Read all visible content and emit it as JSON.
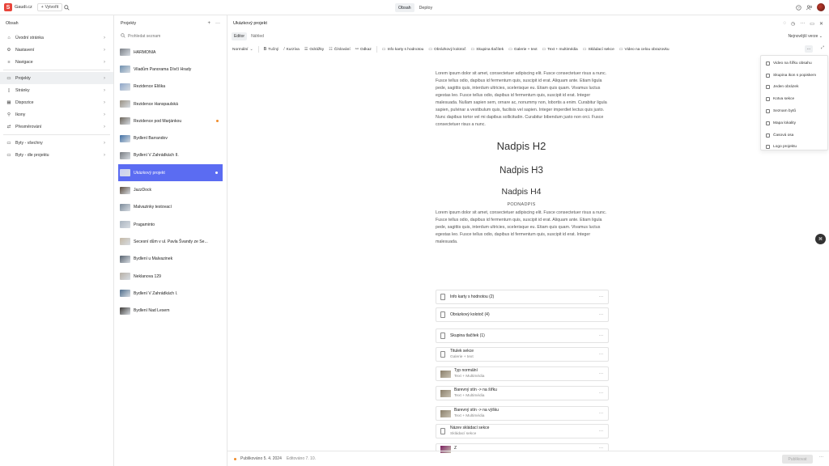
{
  "topbar": {
    "site_name": "Gaudi.cz",
    "create_label": "Vytvořit",
    "nav": [
      "Obsah",
      "Deploy"
    ]
  },
  "leftnav": {
    "title": "Obsah",
    "items": [
      {
        "label": "Úvodní stránka",
        "icon": "home-icon"
      },
      {
        "label": "Nastavení",
        "icon": "gear-icon"
      },
      {
        "label": "Navigace",
        "icon": "menu-icon"
      },
      {
        "label": "Projekty",
        "icon": "folder-icon"
      },
      {
        "label": "Stránky",
        "icon": "page-icon"
      },
      {
        "label": "Dispozice",
        "icon": "layout-icon"
      },
      {
        "label": "Ikony",
        "icon": "pin-icon"
      },
      {
        "label": "Přesměrování",
        "icon": "redirect-icon"
      },
      {
        "label": "Byty - všechny",
        "icon": "folder-icon"
      },
      {
        "label": "Byty - dle projektu",
        "icon": "folder-icon"
      }
    ]
  },
  "projects": {
    "title": "Projekty",
    "search_placeholder": "Prohledat seznam",
    "items": [
      {
        "label": "HARMONIA",
        "thumb": "#7a7f86"
      },
      {
        "label": "Viladům Panorama Dívčí Hrady",
        "thumb": "#6e8fae"
      },
      {
        "label": "Rezidence Eliška",
        "thumb": "#8ea6c8"
      },
      {
        "label": "Rezidence Hanspaulská",
        "thumb": "#9a9284"
      },
      {
        "label": "Rezidence pod Marjánkou",
        "thumb": "#6b6459"
      },
      {
        "label": "Bydlení Barrandov",
        "thumb": "#3f6fa3"
      },
      {
        "label": "Bydlení V Zahrádkách II.",
        "thumb": "#777b80"
      },
      {
        "label": "Ukázkový projekt",
        "thumb": "#c9d0f5"
      },
      {
        "label": "JazzDock",
        "thumb": "#5a4a3c"
      },
      {
        "label": "Malvazinky testovací",
        "thumb": "#7b8a99"
      },
      {
        "label": "Pragaminto",
        "thumb": "#aab4bf"
      },
      {
        "label": "Secesní dům v ul. Pavla Švandy ze Se...",
        "thumb": "#c4b8a4"
      },
      {
        "label": "Bydlení u Malvazinek",
        "thumb": "#57626e"
      },
      {
        "label": "Neklanova 129",
        "thumb": "#b7b0a6"
      },
      {
        "label": "Bydlení V Zahrádkách I.",
        "thumb": "#4f6e8c"
      },
      {
        "label": "Bydlení Nad Lesem",
        "thumb": "#3e3b38"
      }
    ]
  },
  "editor": {
    "title": "Ukázkový projekt",
    "tabs": [
      "Editor",
      "Náhled"
    ],
    "version": "Nejnovější verze",
    "toolbar": [
      "Normální",
      "Tučný",
      "Kurzíva",
      "Odrážky",
      "Číslování",
      "Odkaz",
      "Info karty s hodnotou",
      "Obrázkový kolotoč",
      "Skupina tlačítek",
      "Galerie + text",
      "Text + multimédia",
      "Skládací sekce",
      "Video na celou obrazovku"
    ],
    "paragraph1": "Lorem ipsum dolor sit amet, consectetuer adipiscing elit. Fusce consectetuer risus a nunc. Fusce tellus odio, dapibus id fermentum quis, suscipit id erat. Aliquam ante. Etiam ligula pede, sagittis quis, interdum ultricies, scelerisque eu. Etiam quis quam. Vivamus luctus egestas leo. Fusce tellus odio, dapibus id fermentum quis, suscipit id erat. Integer malesuada. Nullam sapien sem, ornare ac, nonummy non, lobortis a enim. Curabitur ligula sapien, pulvinar a vestibulum quis, facilisis vel sapien. Integer imperdiet lectus quis justo. Nunc dapibus tortor vel mi dapibus sollicitudin. Curabitur bibendum justo non orci. Fusce consectetuer risus a nunc.",
    "h2": "Nadpis H2",
    "h3": "Nadpis H3",
    "h4": "Nadpis H4",
    "subheading": "PODNADPIS",
    "paragraph2": "Lorem ipsum dolor sit amet, consectetuer adipiscing elit. Fusce consectetuer risus a nunc. Fusce tellus odio, dapibus id fermentum quis, suscipit id erat. Aliquam ante. Etiam ligula pede, sagittis quis, interdum ultricies, scelerisque eu. Etiam quis quam. Vivamus luctus egestas leo. Fusce tellus odio, dapibus id fermentum quis, suscipit id erat. Integer malesuada.",
    "blocks": [
      {
        "title": "Info karty s hodnotou (2)",
        "sub": "",
        "thumb": ""
      },
      {
        "title": "Obrázkový kolotoč (4)",
        "sub": "",
        "thumb": ""
      },
      {
        "title": "Skupina tlačítek (1)",
        "sub": "",
        "thumb": ""
      },
      {
        "title": "Titulek sekce",
        "sub": "Galerie + text",
        "thumb": ""
      },
      {
        "title": "Typ normální",
        "sub": "Text + Multimédia",
        "thumb": "#8a7f6a"
      },
      {
        "title": "Barevný stín -> na šířku",
        "sub": "Text + Multimédia",
        "thumb": "#8a7f6a"
      },
      {
        "title": "Barevný stín -> na výšku",
        "sub": "Text + Multimédia",
        "thumb": "#8a7f6a"
      },
      {
        "title": "Název skládací sekce",
        "sub": "Skládací sekce",
        "thumb": ""
      },
      {
        "title": "Z",
        "sub": "",
        "thumb": "#7b1d5e"
      }
    ]
  },
  "dropdown": {
    "items": [
      "Video na šířku obsahu",
      "Skupina ikon s popiskem",
      "Jeden obrázek",
      "Kotva sekce",
      "Seznam bytů",
      "Mapa lokality",
      "Časová osa",
      "Logo projektu"
    ]
  },
  "footer": {
    "published": "Publikováno 5. 4. 2024",
    "edited": "Editováno 7. 10.",
    "publish_label": "Publikovat"
  }
}
